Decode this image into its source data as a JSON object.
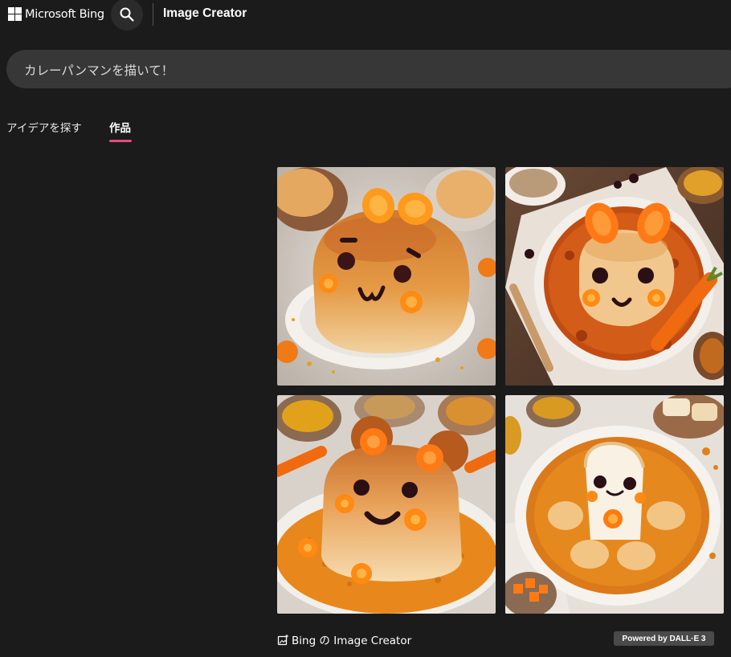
{
  "header": {
    "brand": "Microsoft Bing",
    "app_title": "Image Creator",
    "icons": [
      "windows-logo-icon",
      "search-icon"
    ]
  },
  "prompt": {
    "value": "カレーパンマンを描いて！"
  },
  "tabs": [
    {
      "label": "アイデアを探す",
      "selected": false
    },
    {
      "label": "作品",
      "selected": true
    }
  ],
  "results": {
    "images": [
      {
        "subject": "bread-face-on-plate"
      },
      {
        "subject": "bun-in-curry"
      },
      {
        "subject": "bun-on-turmeric"
      },
      {
        "subject": "toast-figure-in-curry"
      }
    ]
  },
  "footer": {
    "credit": "Bing の Image Creator",
    "powered": "Powered by DALL·E 3"
  },
  "colors": {
    "background": "#1b1b1b",
    "prompt_bg": "#373737",
    "tab_accent": "#e34c7b",
    "badge_bg": "#4a4a4a"
  }
}
